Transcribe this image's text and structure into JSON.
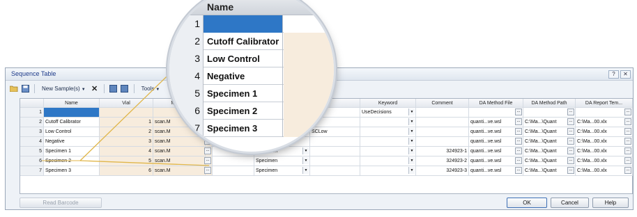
{
  "window": {
    "title": "Sequence Table",
    "help_button": "?",
    "close_button": "✕"
  },
  "toolbar": {
    "new_samples_label": "New Sample(s)",
    "tools_label": "Tools"
  },
  "columns": [
    "Name",
    "Vial",
    "Method",
    "Keyword",
    "Comment",
    "DA Method File",
    "DA Method Path",
    "DA Report Tem..."
  ],
  "rows": [
    {
      "num": "1",
      "name": "",
      "vial": "",
      "method": "",
      "type": "",
      "level": "",
      "keyword": "UseDecisions",
      "comment": "",
      "da_file": "",
      "da_path": "",
      "da_report": ""
    },
    {
      "num": "2",
      "name": "Cutoff Calibrator",
      "vial": "1",
      "method": "scan.M",
      "type": "",
      "level": "",
      "keyword": "",
      "comment": "",
      "da_file": "quanti...ve.wsl",
      "da_path": "C:\\Ma...\\Quant",
      "da_report": "C:\\Ma...00.xlx"
    },
    {
      "num": "3",
      "name": "Low Control",
      "vial": "2",
      "method": "scan.M",
      "type": "",
      "level": "SCLow",
      "keyword": "",
      "comment": "",
      "da_file": "quanti...ve.wsl",
      "da_path": "C:\\Ma...\\Quant",
      "da_report": "C:\\Ma...00.xlx"
    },
    {
      "num": "4",
      "name": "Negative",
      "vial": "3",
      "method": "scan.M",
      "type": "",
      "level": "",
      "keyword": "",
      "comment": "",
      "da_file": "quanti...ve.wsl",
      "da_path": "C:\\Ma...\\Quant",
      "da_report": "C:\\Ma...00.xlx"
    },
    {
      "num": "5",
      "name": "Specimen 1",
      "vial": "4",
      "method": "scan.M",
      "type": "Specimen",
      "level": "",
      "keyword": "",
      "comment": "324923-1",
      "da_file": "quanti...ve.wsl",
      "da_path": "C:\\Ma...\\Quant",
      "da_report": "C:\\Ma...00.xlx"
    },
    {
      "num": "6",
      "name": "Specimen 2",
      "vial": "5",
      "method": "scan.M",
      "type": "Specimen",
      "level": "",
      "keyword": "",
      "comment": "324923-2",
      "da_file": "quanti...ve.wsl",
      "da_path": "C:\\Ma...\\Quant",
      "da_report": "C:\\Ma...00.xlx"
    },
    {
      "num": "7",
      "name": "Specimen 3",
      "vial": "6",
      "method": "scan.M",
      "type": "Specimen",
      "level": "",
      "keyword": "",
      "comment": "324923-3",
      "da_file": "quanti...ve.wsl",
      "da_path": "C:\\Ma...\\Quant",
      "da_report": "C:\\Ma...00.xlx"
    }
  ],
  "buttons": {
    "read_barcode": "Read Barcode",
    "ok": "OK",
    "cancel": "Cancel",
    "help": "Help"
  },
  "magnifier": {
    "header": "Name",
    "rows": [
      {
        "num": "1",
        "name": ""
      },
      {
        "num": "2",
        "name": "Cutoff Calibrator"
      },
      {
        "num": "3",
        "name": "Low Control"
      },
      {
        "num": "4",
        "name": "Negative"
      },
      {
        "num": "5",
        "name": "Specimen 1"
      },
      {
        "num": "6",
        "name": "Specimen 2"
      },
      {
        "num": "7",
        "name": "Specimen 3"
      }
    ]
  },
  "colors": {
    "selection": "#2e77c6",
    "tan_cells": "#f7ecdd",
    "callout_line": "#e0b64a"
  }
}
